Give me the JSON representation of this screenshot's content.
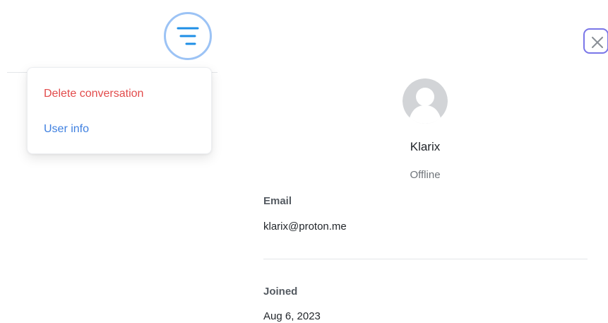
{
  "conversation_menu": {
    "items": [
      {
        "label": "Delete conversation",
        "color": "#e24b4b"
      },
      {
        "label": "User info",
        "color": "#3f80e0"
      }
    ]
  },
  "user_info": {
    "name": "Klarix",
    "status": "Offline",
    "email": {
      "label": "Email",
      "value": "klarix@proton.me"
    },
    "joined": {
      "label": "Joined",
      "value": "Aug 6, 2023"
    }
  },
  "icons": {
    "menu_toggle": "menu-lines-icon",
    "close": "close-icon",
    "avatar": "default-user-avatar-icon"
  },
  "colors": {
    "accent": "#9cc3f5",
    "menu_lines": "#1f8fe6",
    "close_border": "#7a76e8",
    "danger": "#e24b4b",
    "link": "#3f80e0"
  }
}
